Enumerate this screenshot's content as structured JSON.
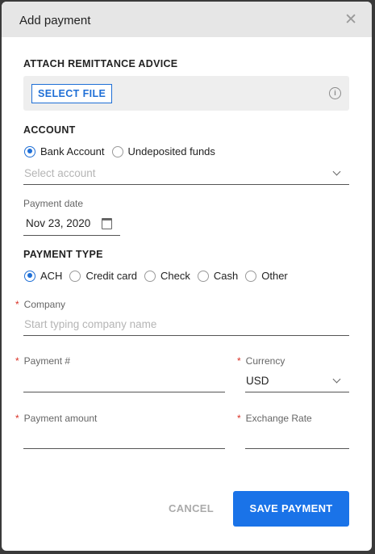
{
  "header": {
    "title": "Add payment"
  },
  "attach": {
    "label": "ATTACH REMITTANCE ADVICE",
    "button": "SELECT FILE"
  },
  "account": {
    "label": "ACCOUNT",
    "options": [
      "Bank Account",
      "Undeposited funds"
    ],
    "selected": "Bank Account",
    "select_placeholder": "Select account"
  },
  "payment_date": {
    "label": "Payment date",
    "value": "Nov 23, 2020"
  },
  "payment_type": {
    "label": "PAYMENT TYPE",
    "options": [
      "ACH",
      "Credit card",
      "Check",
      "Cash",
      "Other"
    ],
    "selected": "ACH"
  },
  "company": {
    "label": "Company",
    "placeholder": "Start typing company name"
  },
  "payment_number": {
    "label": "Payment #",
    "value": ""
  },
  "currency": {
    "label": "Currency",
    "value": "USD"
  },
  "payment_amount": {
    "label": "Payment amount",
    "value": ""
  },
  "exchange_rate": {
    "label": "Exchange Rate",
    "value": ""
  },
  "footer": {
    "cancel": "CANCEL",
    "save": "SAVE PAYMENT"
  },
  "colors": {
    "accent": "#1a73e8",
    "required": "#d93025"
  }
}
